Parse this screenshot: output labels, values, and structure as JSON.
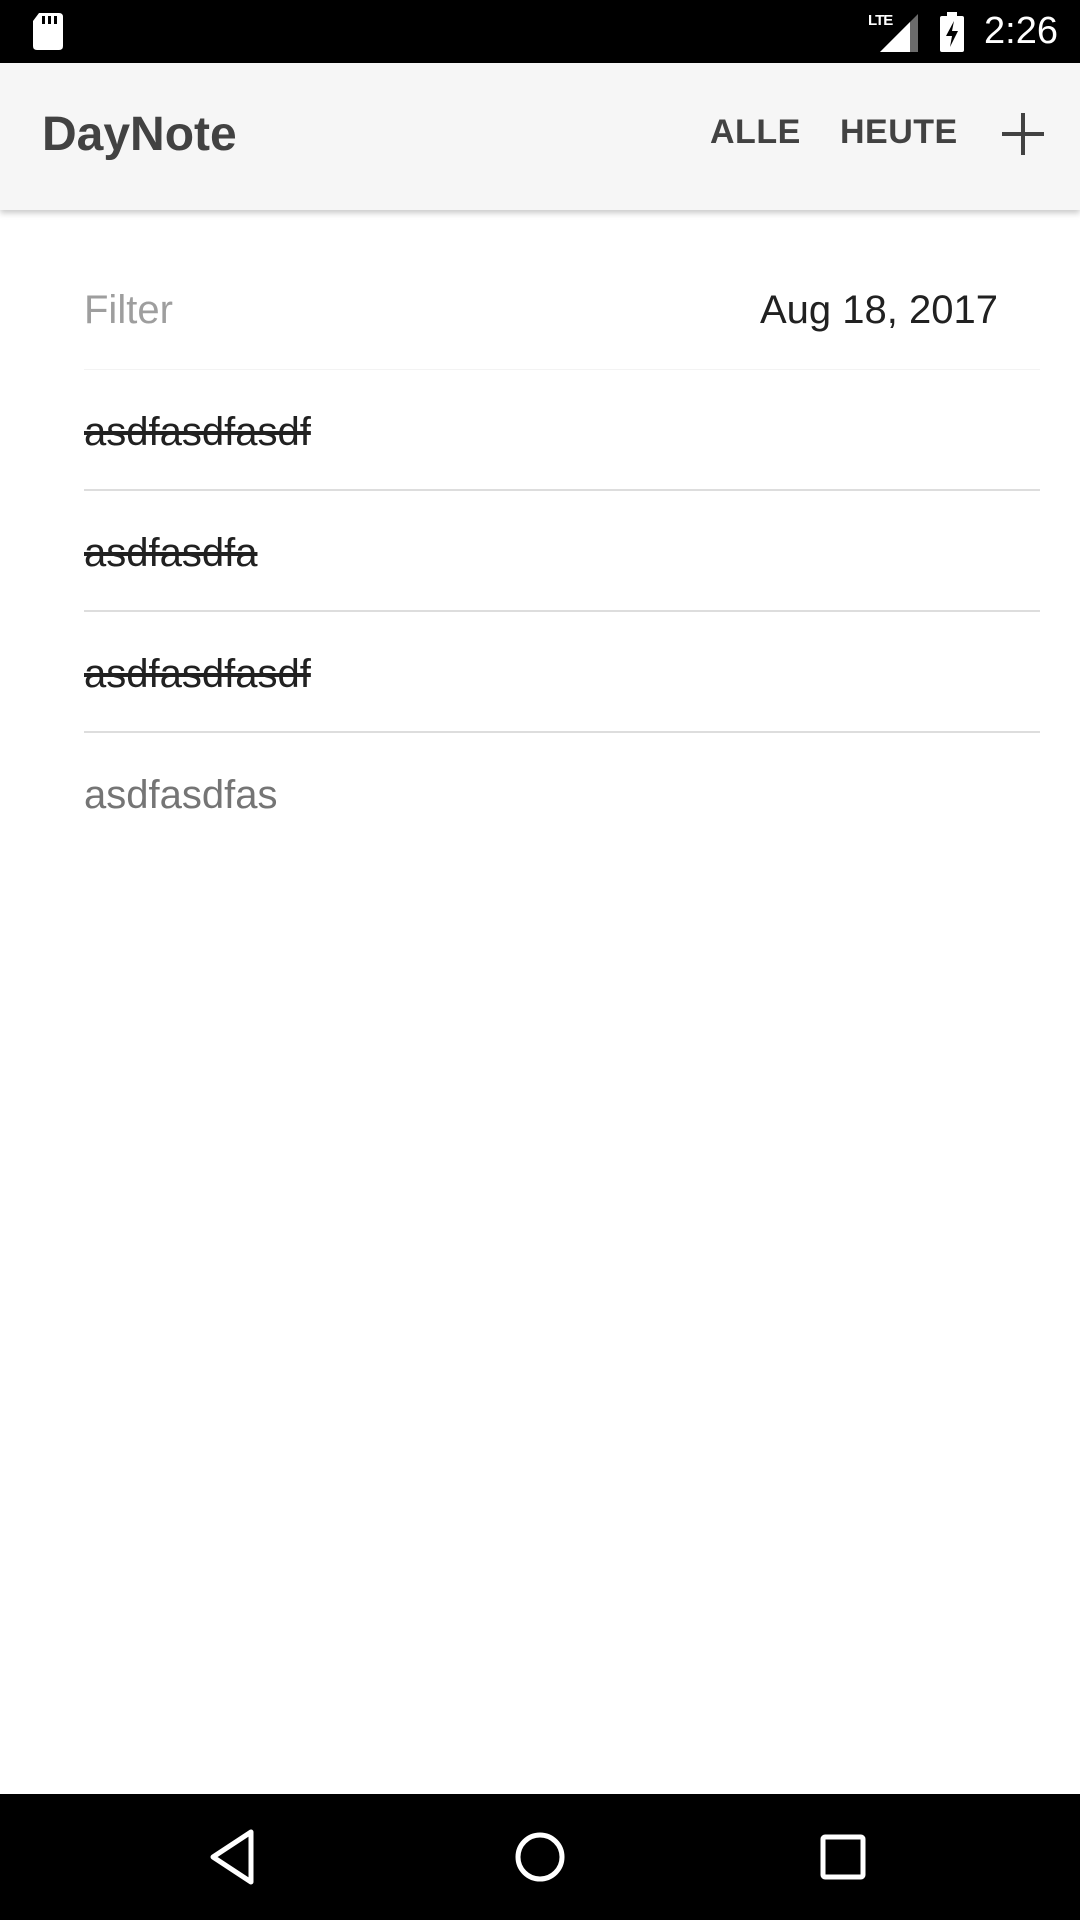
{
  "status_bar": {
    "network_label": "LTE",
    "time": "2:26",
    "icons": [
      "sd-card-icon",
      "signal-icon",
      "battery-charging-icon"
    ]
  },
  "app_bar": {
    "title": "DayNote",
    "actions": {
      "all_label": "ALLE",
      "today_label": "HEUTE",
      "add_icon": "plus-icon"
    }
  },
  "filter": {
    "placeholder": "Filter",
    "date": "Aug 18, 2017"
  },
  "notes": [
    {
      "text": "asdfasdfasdf",
      "done": true
    },
    {
      "text": "asdfasdfa",
      "done": true
    },
    {
      "text": "asdfasdfasdf",
      "done": true
    },
    {
      "text": "asdfasdfas",
      "done": false
    }
  ],
  "nav_bar": {
    "icons": [
      "back-icon",
      "home-icon",
      "recents-icon"
    ]
  },
  "colors": {
    "app_bar_bg": "#f6f6f6",
    "title_text": "#424242",
    "divider": "#dddddd",
    "system_bars": "#000000"
  }
}
